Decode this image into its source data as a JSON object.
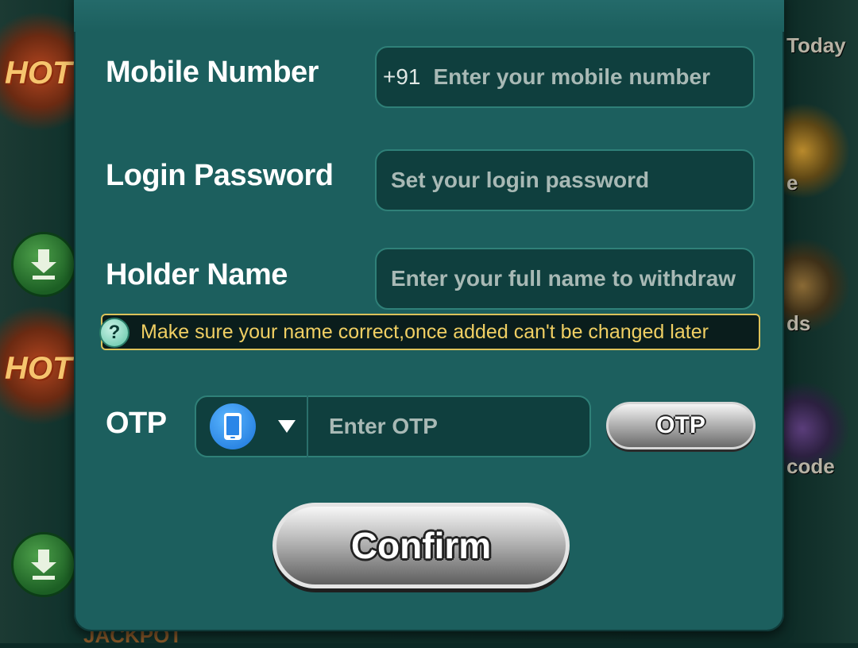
{
  "background": {
    "right_labels": [
      "Today",
      "e",
      "ds",
      "code"
    ],
    "left_hot_labels": [
      "HOT",
      "HOT"
    ],
    "bottom_label": "JACKPOT"
  },
  "form": {
    "mobile": {
      "label": "Mobile Number",
      "prefix": "+91",
      "placeholder": "Enter your mobile number"
    },
    "password": {
      "label": "Login Password",
      "placeholder": "Set your login password"
    },
    "holder": {
      "label": "Holder Name",
      "placeholder": "Enter your full name to withdraw"
    },
    "hint": {
      "icon": "question-icon",
      "text": "Make sure your name correct,once added can't be changed later"
    },
    "otp": {
      "label": "OTP",
      "icon": "phone-icon",
      "placeholder": "Enter OTP",
      "button_label": "OTP"
    },
    "confirm_label": "Confirm"
  },
  "colors": {
    "panel": "#1c5f5e",
    "field": "#0f3f3e",
    "hint_text": "#f0cf63",
    "accent_blue": "#1a73d9"
  }
}
